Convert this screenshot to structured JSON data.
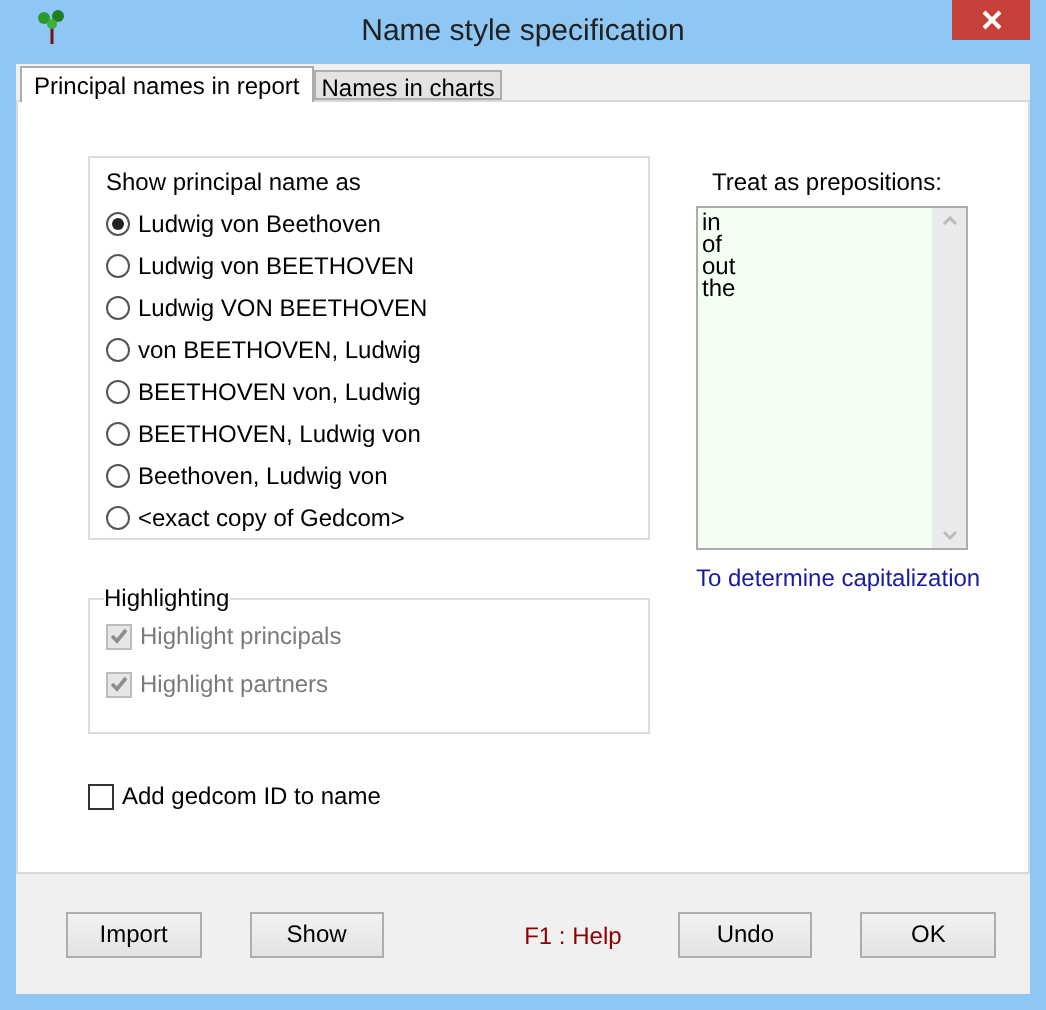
{
  "window": {
    "title": "Name style specification"
  },
  "tabs": [
    {
      "label": "Principal names in report",
      "selected": true
    },
    {
      "label": "Names in charts",
      "selected": false
    }
  ],
  "name_style": {
    "title": "Show principal name as",
    "options": [
      {
        "label": "Ludwig von Beethoven",
        "selected": true
      },
      {
        "label": "Ludwig von BEETHOVEN",
        "selected": false
      },
      {
        "label": "Ludwig VON BEETHOVEN",
        "selected": false
      },
      {
        "label": "von BEETHOVEN, Ludwig",
        "selected": false
      },
      {
        "label": "BEETHOVEN von, Ludwig",
        "selected": false
      },
      {
        "label": "BEETHOVEN, Ludwig von",
        "selected": false
      },
      {
        "label": "Beethoven, Ludwig von",
        "selected": false
      },
      {
        "label": "<exact copy of Gedcom>",
        "selected": false
      }
    ]
  },
  "highlighting": {
    "title": "Highlighting",
    "options": [
      {
        "label": "Highlight principals",
        "checked": true,
        "disabled": true
      },
      {
        "label": "Highlight partners",
        "checked": true,
        "disabled": true
      }
    ]
  },
  "add_id": {
    "label": "Add gedcom ID to name",
    "checked": false
  },
  "prepositions": {
    "label": "Treat as prepositions:",
    "items": [
      "in",
      "of",
      "out",
      "the"
    ],
    "note": "To determine capitalization"
  },
  "buttons": [
    {
      "label": "Import"
    },
    {
      "label": "Show"
    }
  ],
  "help": "F1 : Help",
  "buttons_right": [
    {
      "label": "Undo"
    },
    {
      "label": "OK"
    }
  ]
}
